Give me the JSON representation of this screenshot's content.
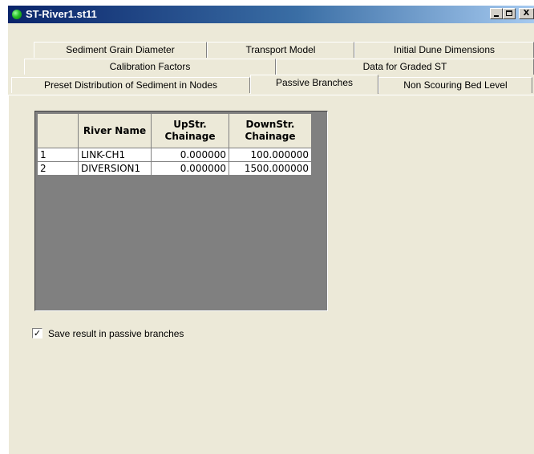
{
  "window": {
    "title": "ST-River1.st11",
    "controls": {
      "minimize": "_",
      "maximize": "□",
      "close": "X"
    }
  },
  "tabs": {
    "row1": [
      "Sediment Grain Diameter",
      "Transport Model",
      "Initial Dune Dimensions"
    ],
    "row2": [
      "Calibration Factors",
      "Data for Graded ST"
    ],
    "row3": [
      "Preset Distribution of Sediment in Nodes",
      "Passive Branches",
      "Non Scouring Bed Level"
    ],
    "active": "Passive Branches"
  },
  "grid": {
    "headers": [
      "",
      "River Name",
      "UpStr.\nChainage",
      "DownStr.\nChainage"
    ],
    "header_up_1": "UpStr.",
    "header_up_2": "Chainage",
    "header_down_1": "DownStr.",
    "header_down_2": "Chainage",
    "header_river": "River Name",
    "rows": [
      {
        "index": "1",
        "river_name": "LINK-CH1",
        "up_chainage": "0.000000",
        "down_chainage": "100.000000"
      },
      {
        "index": "2",
        "river_name": "DIVERSION1",
        "up_chainage": "0.000000",
        "down_chainage": "1500.000000"
      }
    ]
  },
  "options": {
    "save_passive": {
      "label": "Save result in passive branches",
      "checked": true,
      "mark": "✓"
    }
  }
}
